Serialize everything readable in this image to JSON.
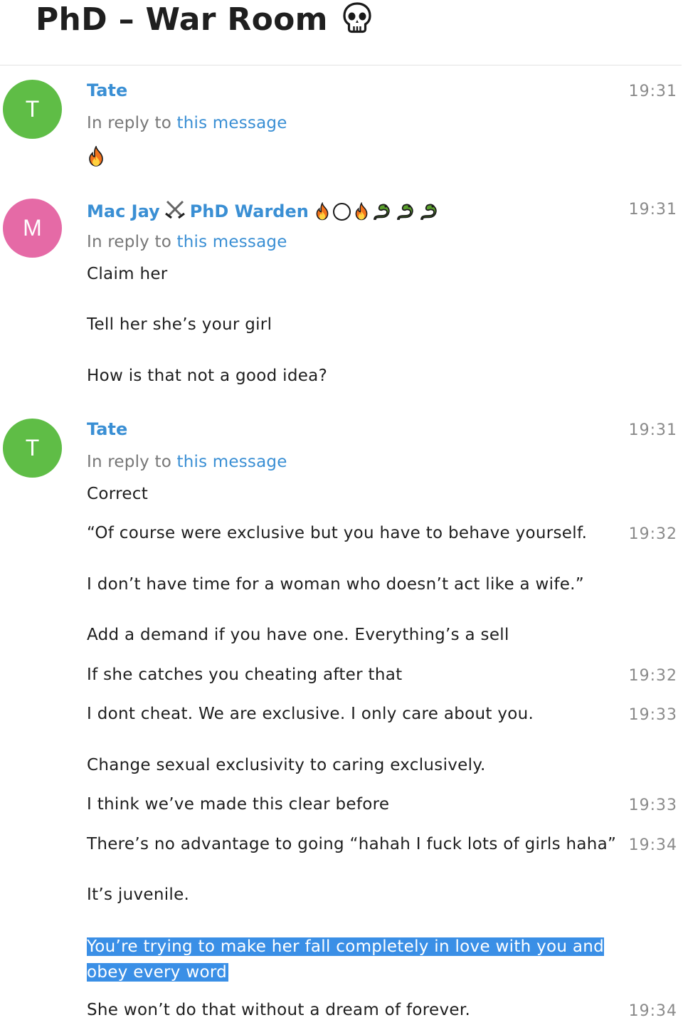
{
  "chat": {
    "title": "PhD – War Room"
  },
  "colors": {
    "green_avatar": "#5fbd46",
    "pink_avatar": "#e56aa6",
    "link_blue": "#3a8fd4",
    "selection_blue": "#3a8fe6"
  },
  "messages": [
    {
      "avatar": "T",
      "sender": "Tate",
      "time": "19:31",
      "reply_prefix": "In reply to",
      "reply_link": "this message"
    },
    {
      "avatar": "M",
      "sender_name": "Mac Jay",
      "sender_title": "PhD Warden",
      "time": "19:31",
      "reply_prefix": "In reply to",
      "reply_link": "this message",
      "lines": [
        "Claim her",
        "Tell her she’s your girl",
        "How is that not a good idea?"
      ]
    },
    {
      "avatar": "T",
      "sender": "Tate",
      "time": "19:31",
      "reply_prefix": "In reply to",
      "reply_link": "this message",
      "first_line": "Correct"
    }
  ],
  "followups": [
    {
      "text": "“Of course were exclusive but you have to behave yourself.",
      "time": "19:32"
    },
    {
      "text": "I don’t have time for a woman who doesn’t act like a wife.”"
    },
    {
      "text": "Add a demand if you have one. Everything’s a sell"
    },
    {
      "text": "If she catches you cheating after that",
      "time": "19:32"
    },
    {
      "text": "I dont cheat. We are exclusive. I only care about you.",
      "time": "19:33"
    },
    {
      "text": "Change sexual exclusivity to caring exclusively."
    },
    {
      "text": "I think we’ve made this clear before",
      "time": "19:33"
    },
    {
      "text": "There’s no advantage to going “hahah I fuck lots of girls haha”",
      "time": "19:34"
    },
    {
      "text": "It’s juvenile."
    },
    {
      "text": "You’re trying to make her fall completely in love with you and obey every word"
    },
    {
      "text": "She won’t do that without a dream of forever.",
      "time": "19:34"
    }
  ]
}
